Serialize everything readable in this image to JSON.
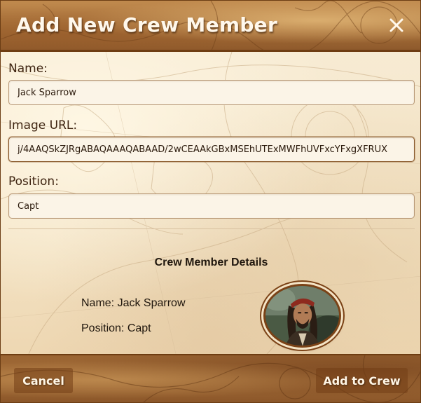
{
  "modal": {
    "title": "Add New Crew Member",
    "close_label": "×"
  },
  "form": {
    "name": {
      "label": "Name:",
      "value": "Jack Sparrow"
    },
    "image_url": {
      "label": "Image URL:",
      "value": "j/4AAQSkZJRgABAQAAAQABAAD/2wCEAAkGBxMSEhUTExMWFhUVFxcYFxgXFRUX"
    },
    "position": {
      "label": "Position:",
      "value": "Capt"
    }
  },
  "details": {
    "title": "Crew Member Details",
    "name_line": "Name: Jack Sparrow",
    "position_line": "Position: Capt",
    "avatar_icon": "crew-portrait"
  },
  "footer": {
    "cancel_label": "Cancel",
    "add_label": "Add to Crew"
  },
  "colors": {
    "header": "#a9713a",
    "parchment": "#f6ead3",
    "border": "#6e3d12",
    "text": "#3e2411"
  }
}
